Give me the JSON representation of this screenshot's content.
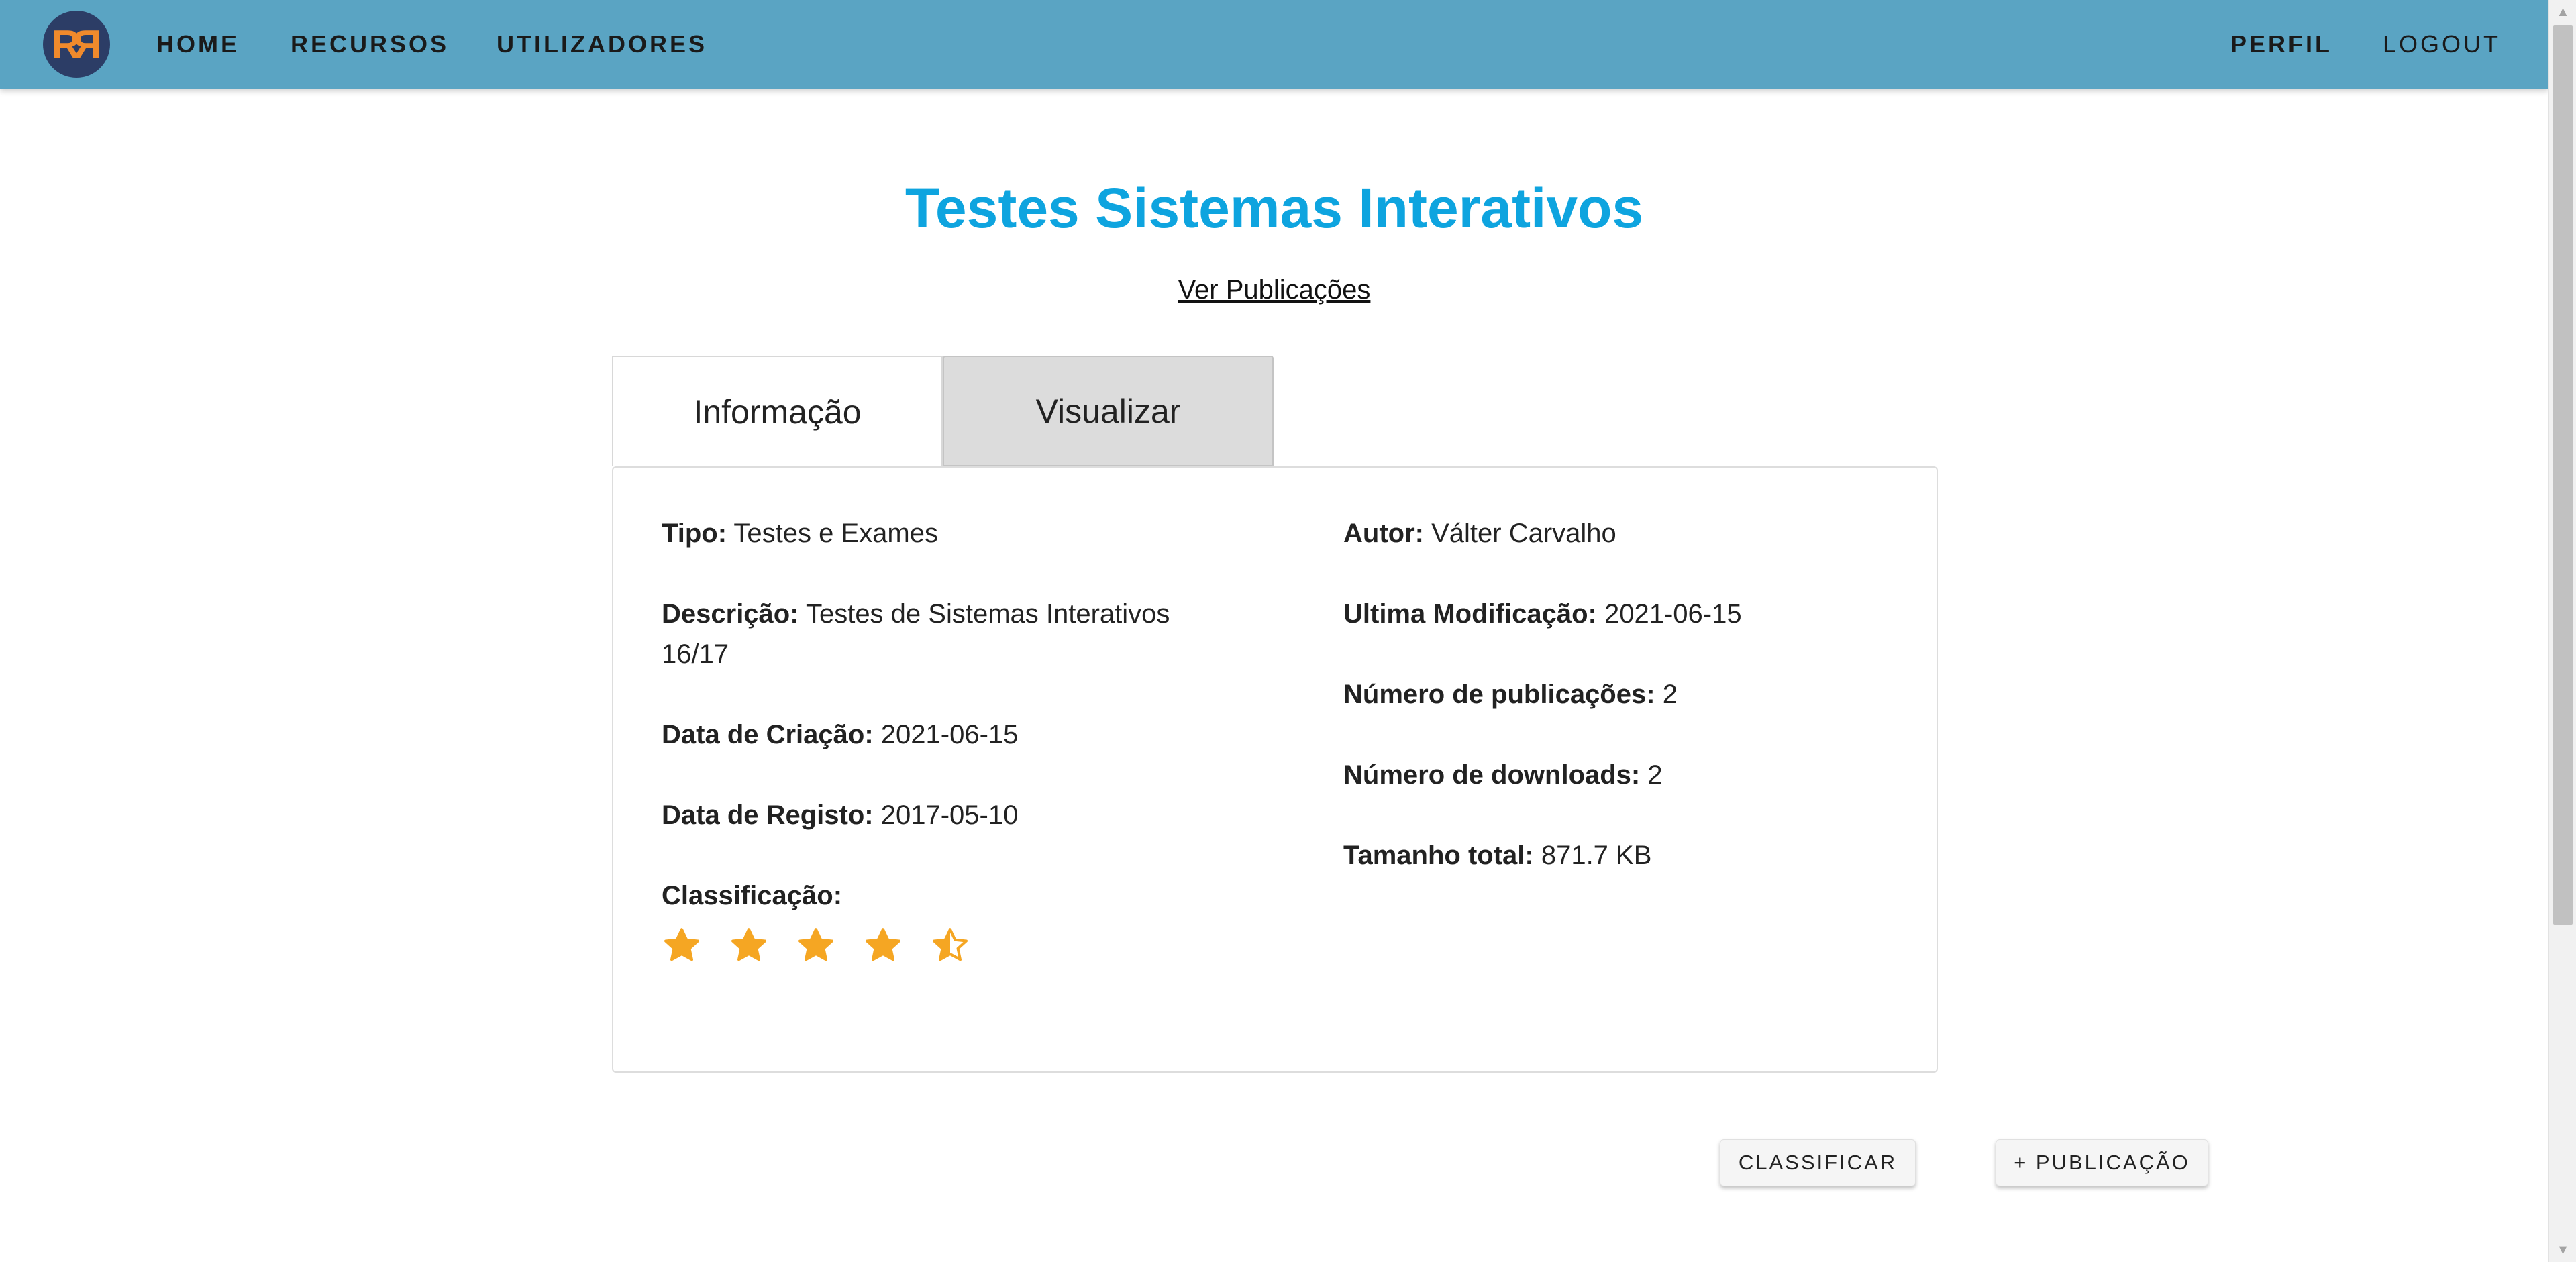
{
  "nav": {
    "logo_text": "RR",
    "home": "HOME",
    "recursos": "RECURSOS",
    "utilizadores": "UTILIZADORES",
    "perfil": "PERFIL",
    "logout": "LOGOUT",
    "bar_color": "#5aa4c3"
  },
  "page": {
    "title": "Testes Sistemas Interativos",
    "title_color": "#0ea4df",
    "view_publications_link": "Ver Publicações"
  },
  "tabs": [
    {
      "label": "Informação",
      "active": true
    },
    {
      "label": "Visualizar",
      "active": false
    }
  ],
  "info": {
    "tipo_label": "Tipo:",
    "tipo_value": "Testes e Exames",
    "descricao_label": "Descrição:",
    "descricao_value_line1": "Testes de Sistemas Interativos",
    "descricao_value_line2": "16/17",
    "data_criacao_label": "Data de Criação:",
    "data_criacao_value": "2021-06-15",
    "data_registo_label": "Data de Registo:",
    "data_registo_value": "2017-05-10",
    "classificacao_label": "Classificação:",
    "rating": 4.5,
    "rating_max": 5,
    "star_color": "#f5a623",
    "autor_label": "Autor:",
    "autor_value": "Válter Carvalho",
    "ultima_mod_label": "Ultima Modificação:",
    "ultima_mod_value": "2021-06-15",
    "num_pub_label": "Número de publicações:",
    "num_pub_value": "2",
    "num_down_label": "Número de downloads:",
    "num_down_value": "2",
    "tamanho_label": "Tamanho total:",
    "tamanho_value": "871.7 KB"
  },
  "actions": {
    "classificar": "CLASSIFICAR",
    "publicacao": "+ PUBLICAÇÃO"
  }
}
